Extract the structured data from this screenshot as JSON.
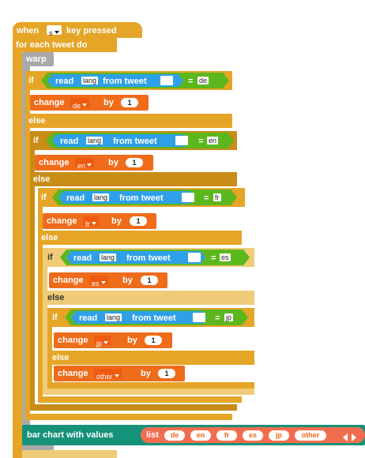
{
  "hat": {
    "when": "when",
    "key": "s",
    "key_pressed": "key pressed"
  },
  "foreach": {
    "label": "for each tweet do"
  },
  "warp": {
    "label": "warp"
  },
  "kw": {
    "if": "if",
    "else": "else",
    "change": "change",
    "by": "by",
    "read": "read",
    "from_tweet": "from tweet",
    "eq": "="
  },
  "conds": [
    {
      "field": "lang",
      "value": "de"
    },
    {
      "field": "lang",
      "value": "en"
    },
    {
      "field": "lang",
      "value": "fr"
    },
    {
      "field": "lang",
      "value": "es"
    },
    {
      "field": "lang",
      "value": "jp"
    }
  ],
  "changes": [
    {
      "var": "de",
      "amount": "1"
    },
    {
      "var": "en",
      "amount": "1"
    },
    {
      "var": "fr",
      "amount": "1"
    },
    {
      "var": "es",
      "amount": "1"
    },
    {
      "var": "jp",
      "amount": "1"
    },
    {
      "var": "other",
      "amount": "1"
    }
  ],
  "chart": {
    "label": "bar chart with values",
    "list": "list",
    "items": [
      "de",
      "en",
      "fr",
      "es",
      "jp",
      "other"
    ]
  },
  "colors": {
    "control": "#e5a527",
    "variables": "#ef6c1a",
    "sensing": "#2fa0e8",
    "operators": "#5cb71d",
    "extension": "#16927a",
    "warp": "#a9a9a9"
  }
}
